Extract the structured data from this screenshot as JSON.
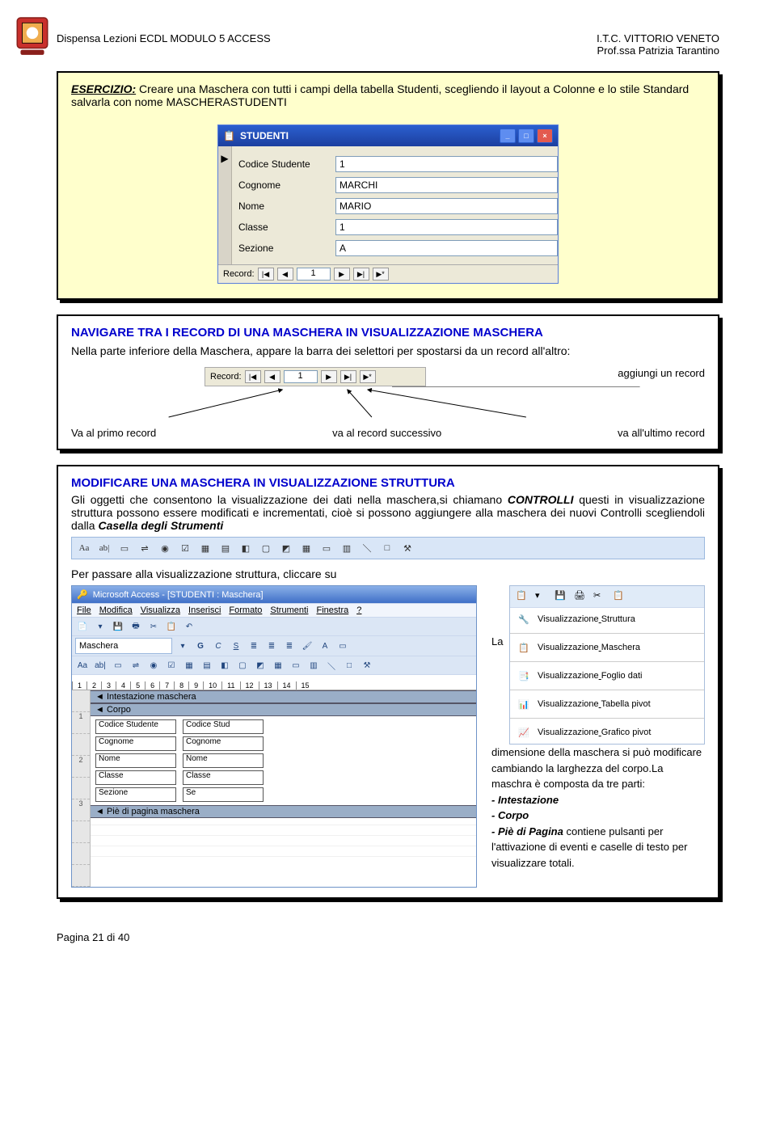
{
  "header": {
    "left": "Dispensa Lezioni ECDL  MODULO 5 ACCESS",
    "right1": "I.T.C. VITTORIO VENETO",
    "right2": "Prof.ssa Patrizia Tarantino"
  },
  "box1": {
    "prefix": "ESERCIZIO:",
    "text": " Creare una Maschera con tutti i campi della tabella Studenti, scegliendo il layout a Colonne e lo stile Standard salvarla con nome MASCHERASTUDENTI"
  },
  "form": {
    "title": "STUDENTI",
    "rows": [
      {
        "label": "Codice Studente",
        "value": "1"
      },
      {
        "label": "Cognome",
        "value": "MARCHI"
      },
      {
        "label": "Nome",
        "value": "MARIO"
      },
      {
        "label": "Classe",
        "value": "1"
      },
      {
        "label": "Sezione",
        "value": "A"
      }
    ],
    "record_label": "Record:",
    "record_value": "1"
  },
  "box2": {
    "hdr1": "NAVIGARE TRA I RECORD DI UNA MASCHERA IN VISUALIZZAZIONE MASCHERA",
    "text": "Nella parte inferiore della Maschera, appare la barra dei selettori per spostarsi da un record all'altro:",
    "aggiungi": "aggiungi un record",
    "lbl_primo": "Va al primo record",
    "lbl_succ": "va al record successivo",
    "lbl_ultimo": "va all'ultimo record",
    "rec_label": "Record:",
    "rec_value": "1"
  },
  "box3": {
    "hdr": "MODIFICARE UNA MASCHERA IN VISUALIZZAZIONE STRUTTURA",
    "p1a": "Gli oggetti che consentono la visualizzazione dei dati nella maschera,si chiamano ",
    "p1b": "CONTROLLI",
    "p1c": " questi in visualizzazione struttura possono essere modificati e incrementati, cioè si possono aggiungere alla maschera dei nuovi Controlli scegliendoli dalla ",
    "p1d": "Casella degli Strumenti",
    "p2": "Per passare alla visualizzazione struttura, cliccare su",
    "menu": [
      "Visualizzazione Struttura",
      "Visualizzazione Maschera",
      "Visualizzazione Foglio dati",
      "Visualizzazione Tabella pivot",
      "Visualizzazione Grafico pivot"
    ],
    "ls": {
      "title": "Microsoft Access - [STUDENTI : Maschera]",
      "menubar": [
        "File",
        "Modifica",
        "Visualizza",
        "Inserisci",
        "Formato",
        "Strumenti",
        "Finestra",
        "?"
      ],
      "sel": "Maschera",
      "bands": {
        "intest": "Intestazione maschera",
        "corpo": "Corpo",
        "pie": "Piè di pagina maschera"
      },
      "fields": [
        {
          "l": "Codice Studente",
          "r": "Codice Stud"
        },
        {
          "l": "Cognome",
          "r": "Cognome"
        },
        {
          "l": "Nome",
          "r": "Nome"
        },
        {
          "l": "Classe",
          "r": "Classe"
        },
        {
          "l": "Sezione",
          "r": "Se"
        }
      ]
    },
    "side": {
      "p1": "La dimensione della maschera si può modificare cambiando la larghezza del corpo.La maschra è composta da tre parti:",
      "i1": "- Intestazione",
      "i2": "- Corpo",
      "i3a": "- Piè di Pagina",
      "i3b": " contiene pulsanti per l'attivazione di eventi e caselle di testo per visualizzare totali."
    }
  },
  "footer": "Pagina 21 di 40",
  "toolbox": [
    "Aa",
    "ab|",
    "▭",
    "⇌",
    "◉",
    "☑",
    "▦",
    "▤",
    "◧",
    "▢",
    "◩",
    "▦",
    "▭",
    "▥",
    "＼",
    "□",
    "⚒"
  ]
}
